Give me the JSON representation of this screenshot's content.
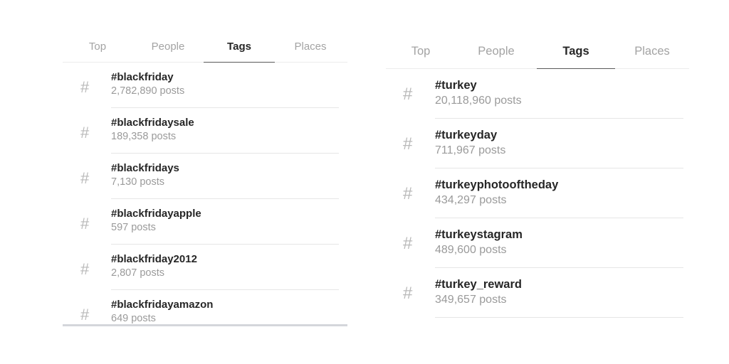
{
  "panels": [
    {
      "tabs": [
        {
          "label": "Top",
          "active": false
        },
        {
          "label": "People",
          "active": false
        },
        {
          "label": "Tags",
          "active": true
        },
        {
          "label": "Places",
          "active": false
        }
      ],
      "hash_icon": "#",
      "results": [
        {
          "tag": "#blackfriday",
          "posts": "2,782,890 posts"
        },
        {
          "tag": "#blackfridaysale",
          "posts": "189,358 posts"
        },
        {
          "tag": "#blackfridays",
          "posts": "7,130 posts"
        },
        {
          "tag": "#blackfridayapple",
          "posts": "597 posts"
        },
        {
          "tag": "#blackfriday2012",
          "posts": "2,807 posts"
        },
        {
          "tag": "#blackfridayamazon",
          "posts": "649 posts"
        }
      ]
    },
    {
      "tabs": [
        {
          "label": "Top",
          "active": false
        },
        {
          "label": "People",
          "active": false
        },
        {
          "label": "Tags",
          "active": true
        },
        {
          "label": "Places",
          "active": false
        }
      ],
      "hash_icon": "#",
      "results": [
        {
          "tag": "#turkey",
          "posts": "20,118,960 posts"
        },
        {
          "tag": "#turkeyday",
          "posts": "711,967 posts"
        },
        {
          "tag": "#turkeyphotooftheday",
          "posts": "434,297 posts"
        },
        {
          "tag": "#turkeystagram",
          "posts": "489,600 posts"
        },
        {
          "tag": "#turkey_reward",
          "posts": "349,657 posts"
        }
      ]
    }
  ],
  "colors": {
    "active_tab": "#262626",
    "inactive_tab": "#a3a3a3",
    "tag_name": "#262626",
    "post_count": "#9a9a9a"
  }
}
